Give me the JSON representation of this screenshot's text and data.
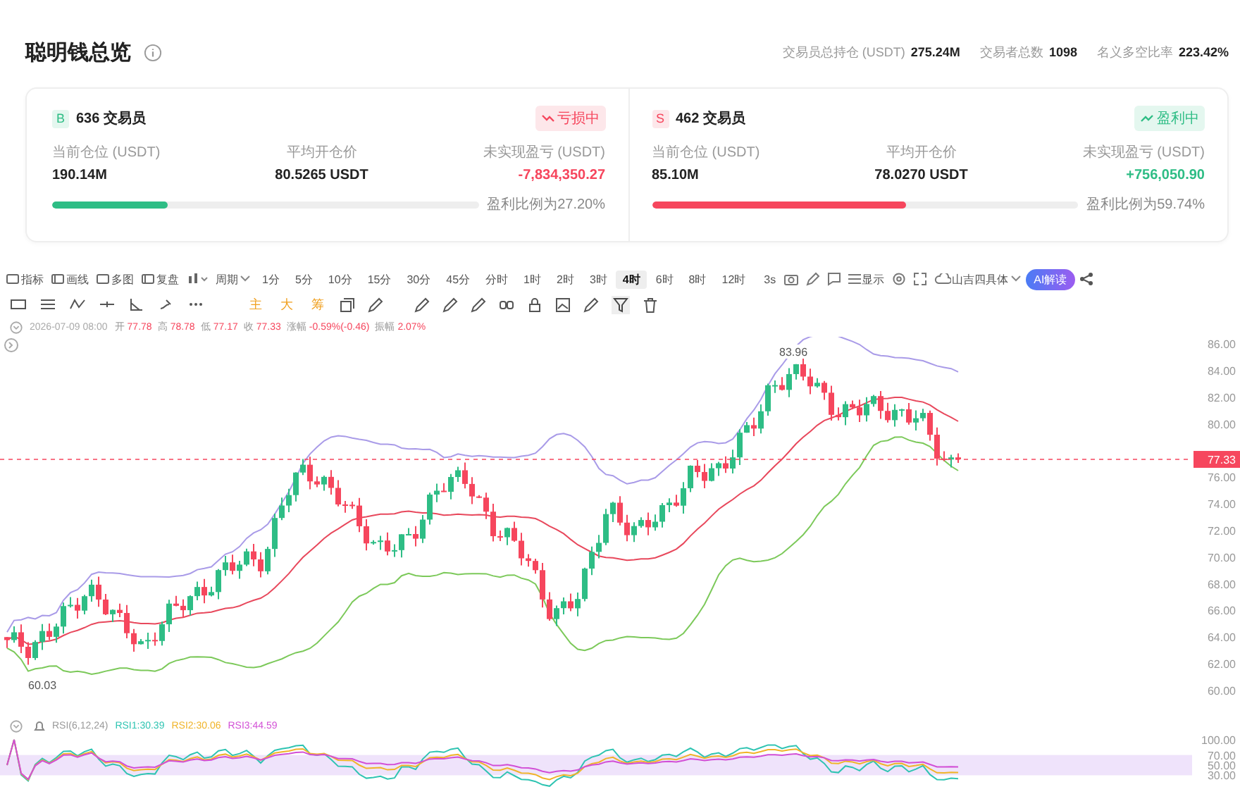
{
  "header": {
    "title": "聪明钱总览",
    "stats": [
      {
        "label": "交易员总持仓 (USDT)",
        "value": "275.24M"
      },
      {
        "label": "交易者总数",
        "value": "1098"
      },
      {
        "label": "名义多空比率",
        "value": "223.42%"
      }
    ]
  },
  "sides": [
    {
      "kind": "long",
      "badge": "B",
      "traders": "636 交易员",
      "status": "亏损中",
      "in_profit": false,
      "metrics": [
        {
          "label": "当前仓位 (USDT)",
          "value": "190.14M"
        },
        {
          "label": "平均开仓价",
          "value": "80.5265 USDT"
        },
        {
          "label": "未实现盈亏 (USDT)",
          "value": "-7,834,350.27"
        }
      ],
      "level": 0.272,
      "ratio": "盈利比例为27.20%"
    },
    {
      "kind": "short",
      "badge": "S",
      "traders": "462 交易员",
      "status": "盈利中",
      "in_profit": true,
      "metrics": [
        {
          "label": "当前仓位 (USDT)",
          "value": "85.10M"
        },
        {
          "label": "平均开仓价",
          "value": "78.0270 USDT"
        },
        {
          "label": "未实现盈亏 (USDT)",
          "value": "+756,050.90"
        }
      ],
      "level": 0.597,
      "ratio": "盈利比例为59.74%"
    }
  ],
  "toolbar": {
    "tools": [
      {
        "label": "指标"
      },
      {
        "label": "画线"
      },
      {
        "label": "多图"
      },
      {
        "label": "复盘"
      }
    ],
    "period_menu": "周期",
    "periods": [
      {
        "label": "1分",
        "selected": false
      },
      {
        "label": "5分",
        "selected": false
      },
      {
        "label": "10分",
        "selected": false
      },
      {
        "label": "15分",
        "selected": false
      },
      {
        "label": "30分",
        "selected": false
      },
      {
        "label": "45分",
        "selected": false
      },
      {
        "label": "分时",
        "selected": false
      },
      {
        "label": "1时",
        "selected": false
      },
      {
        "label": "2时",
        "selected": false
      },
      {
        "label": "3时",
        "selected": false
      },
      {
        "label": "4时",
        "selected": true
      },
      {
        "label": "6时",
        "selected": false
      },
      {
        "label": "8时",
        "selected": false
      },
      {
        "label": "12时",
        "selected": false
      }
    ],
    "refresh": "3s",
    "display": "显示",
    "font_menu": "山吉四具体",
    "ai_button": "AI解读"
  },
  "draw_marks": [
    "主",
    "大",
    "筹"
  ],
  "ohlc": {
    "date": "2026-07-09 08:00",
    "fields": [
      {
        "label": "开",
        "value": "77.78"
      },
      {
        "label": "高",
        "value": "78.78"
      },
      {
        "label": "低",
        "value": "77.17"
      },
      {
        "label": "收",
        "value": "77.33"
      },
      {
        "label": "涨幅",
        "value": "-0.59%(-0.46)"
      },
      {
        "label": "振幅",
        "value": "2.07%"
      }
    ]
  },
  "chart": {
    "price_axis": [
      "86.00",
      "84.00",
      "82.00",
      "80.00",
      "76.00",
      "74.00",
      "72.00",
      "70.00",
      "68.00",
      "66.00",
      "64.00",
      "62.00",
      "60.00"
    ],
    "last_price": "77.33",
    "high_label": "83.96",
    "low_label": "60.03"
  },
  "rsi": {
    "title": "RSI(6,12,24)",
    "lines": [
      {
        "label": "RSI1:30.39",
        "color": "#2fc4b2"
      },
      {
        "label": "RSI2:30.06",
        "color": "#f0b429"
      },
      {
        "label": "RSI3:44.59",
        "color": "#d24fd6"
      }
    ],
    "axis": [
      "100.00",
      "70.00",
      "50.00",
      "30.00"
    ]
  }
}
